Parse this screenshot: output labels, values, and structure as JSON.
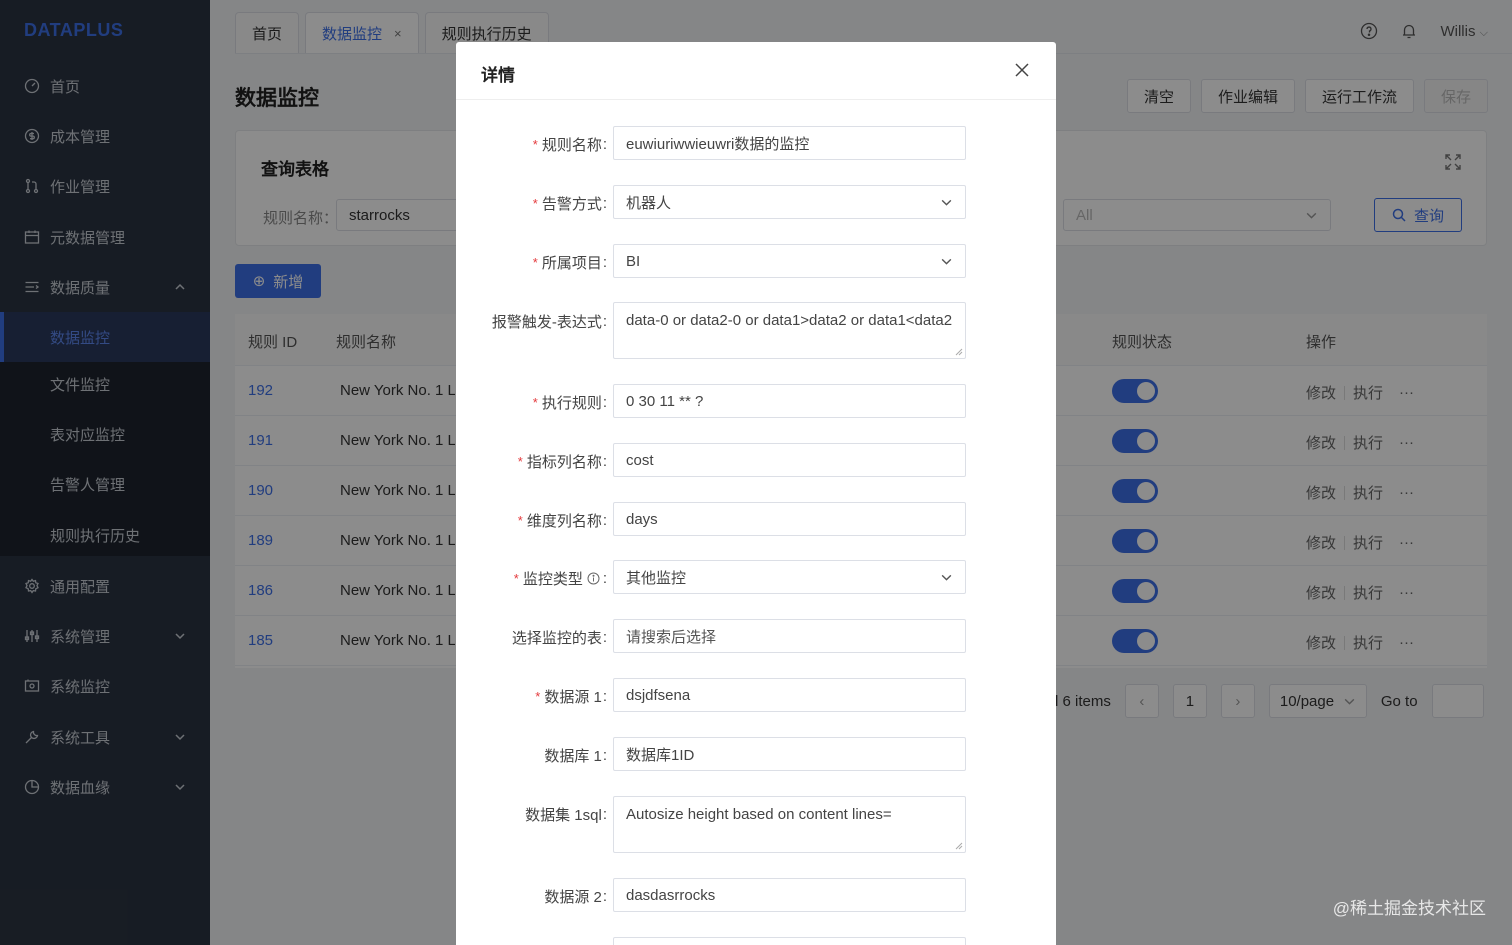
{
  "brand": {
    "logo": "DATAPLUS",
    "accent": "#3d6fe8"
  },
  "sidebar": {
    "items": [
      {
        "label": "首页",
        "icon": "dashboard-icon"
      },
      {
        "label": "成本管理",
        "icon": "dollar-icon"
      },
      {
        "label": "作业管理",
        "icon": "merge-icon"
      },
      {
        "label": "元数据管理",
        "icon": "calendar-icon"
      },
      {
        "label": "数据质量",
        "icon": "list-icon",
        "expanded": true
      },
      {
        "label": "通用配置",
        "icon": "gear-icon"
      },
      {
        "label": "系统管理",
        "icon": "sliders-icon"
      },
      {
        "label": "系统监控",
        "icon": "monitor-icon"
      },
      {
        "label": "系统工具",
        "icon": "tool-icon"
      },
      {
        "label": "数据血缘",
        "icon": "pie-icon"
      }
    ],
    "submenu": [
      {
        "label": "数据监控",
        "active": true
      },
      {
        "label": "文件监控"
      },
      {
        "label": "表对应监控"
      },
      {
        "label": "告警人管理"
      },
      {
        "label": "规则执行历史"
      }
    ]
  },
  "tabs": [
    {
      "label": "首页"
    },
    {
      "label": "数据监控",
      "active": true,
      "close": "×"
    },
    {
      "label": "规则执行历史"
    }
  ],
  "header": {
    "user": "Willis"
  },
  "page": {
    "title": "数据监控",
    "actions": [
      "清空",
      "作业编辑",
      "运行工作流",
      "保存"
    ]
  },
  "query": {
    "title": "查询表格",
    "name_label": "规则名称：",
    "name_value": "starrocks",
    "status_value": "All",
    "search_label": "查询"
  },
  "add_label": "新增",
  "table": {
    "headers": [
      "规则 ID",
      "规则名称",
      "规则状态",
      "操作"
    ],
    "rows": [
      {
        "id": "192",
        "name": "New York No. 1 L"
      },
      {
        "id": "191",
        "name": "New York No. 1 L"
      },
      {
        "id": "190",
        "name": "New York No. 1 L"
      },
      {
        "id": "189",
        "name": "New York No. 1 L"
      },
      {
        "id": "186",
        "name": "New York No. 1 L"
      },
      {
        "id": "185",
        "name": "New York No. 1 L"
      }
    ],
    "op_edit": "修改",
    "op_run": "执行",
    "op_more": "···"
  },
  "pager": {
    "total": "l 6 items",
    "current": "1",
    "page_size": "10/page",
    "goto": "Go to"
  },
  "modal": {
    "title": "详情",
    "fields": [
      {
        "label": "规则名称",
        "required": true,
        "value": "euwiuriwwieuwri数据的监控",
        "kind": "input"
      },
      {
        "label": "告警方式",
        "required": true,
        "value": "机器人",
        "kind": "select"
      },
      {
        "label": "所属项目",
        "required": true,
        "value": "BI",
        "kind": "select"
      },
      {
        "label": "报警触发-表达式",
        "required": false,
        "value": "data-0 or data2-0 or data1>data2 or data1<data2",
        "kind": "textarea"
      },
      {
        "label": "执行规则",
        "required": true,
        "value": "0 30 11 ** ?",
        "kind": "input"
      },
      {
        "label": "指标列名称",
        "required": true,
        "value": "cost",
        "kind": "input"
      },
      {
        "label": "维度列名称",
        "required": true,
        "value": "days",
        "kind": "input"
      },
      {
        "label": "监控类型",
        "required": true,
        "value": "其他监控",
        "kind": "select",
        "info": true
      },
      {
        "label": "选择监控的表",
        "required": false,
        "value": "请搜索后选择",
        "kind": "input"
      },
      {
        "label": "数据源 1",
        "required": true,
        "value": "dsjdfsena",
        "kind": "input"
      },
      {
        "label": "数据库 1",
        "required": false,
        "value": "数据库1ID",
        "kind": "input"
      },
      {
        "label": "数据集 1sql",
        "required": false,
        "value": "Autosize height based on content lines=",
        "kind": "textarea"
      },
      {
        "label": "数据源 2",
        "required": false,
        "value": "dasdasrrocks",
        "kind": "input"
      }
    ]
  },
  "watermark": "@稀土掘金技术社区"
}
